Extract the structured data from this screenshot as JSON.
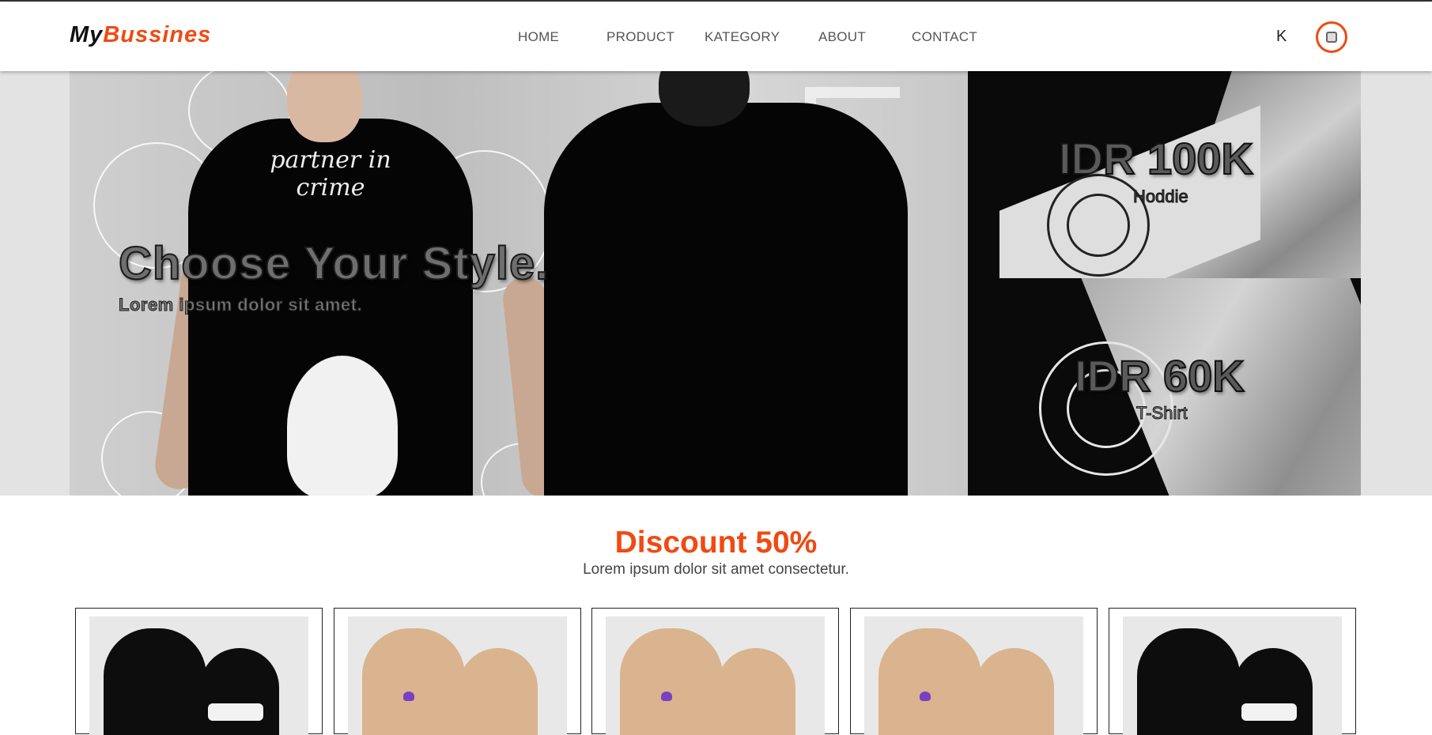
{
  "header": {
    "logo_part1": "My",
    "logo_part2": "Bussines",
    "nav": [
      "HOME",
      "PRODUCT",
      "KATEGORY",
      "ABOUT",
      "CONTACT"
    ],
    "user_initial": "K",
    "accent_color": "#f04a12"
  },
  "hero": {
    "title": "Choose Your Style.",
    "subtitle": "Lorem ipsum dolor sit amet.",
    "shirt_print": "partner in crime"
  },
  "promos": [
    {
      "price": "IDR 100K",
      "product": "Hoddie"
    },
    {
      "price": "IDR 60K",
      "product": "T-Shirt"
    }
  ],
  "discount": {
    "title": "Discount 50%",
    "subtitle": "Lorem ipsum dolor sit amet consectetur."
  },
  "products": [
    {
      "color": "black"
    },
    {
      "color": "tan"
    },
    {
      "color": "tan"
    },
    {
      "color": "tan"
    },
    {
      "color": "black"
    }
  ]
}
